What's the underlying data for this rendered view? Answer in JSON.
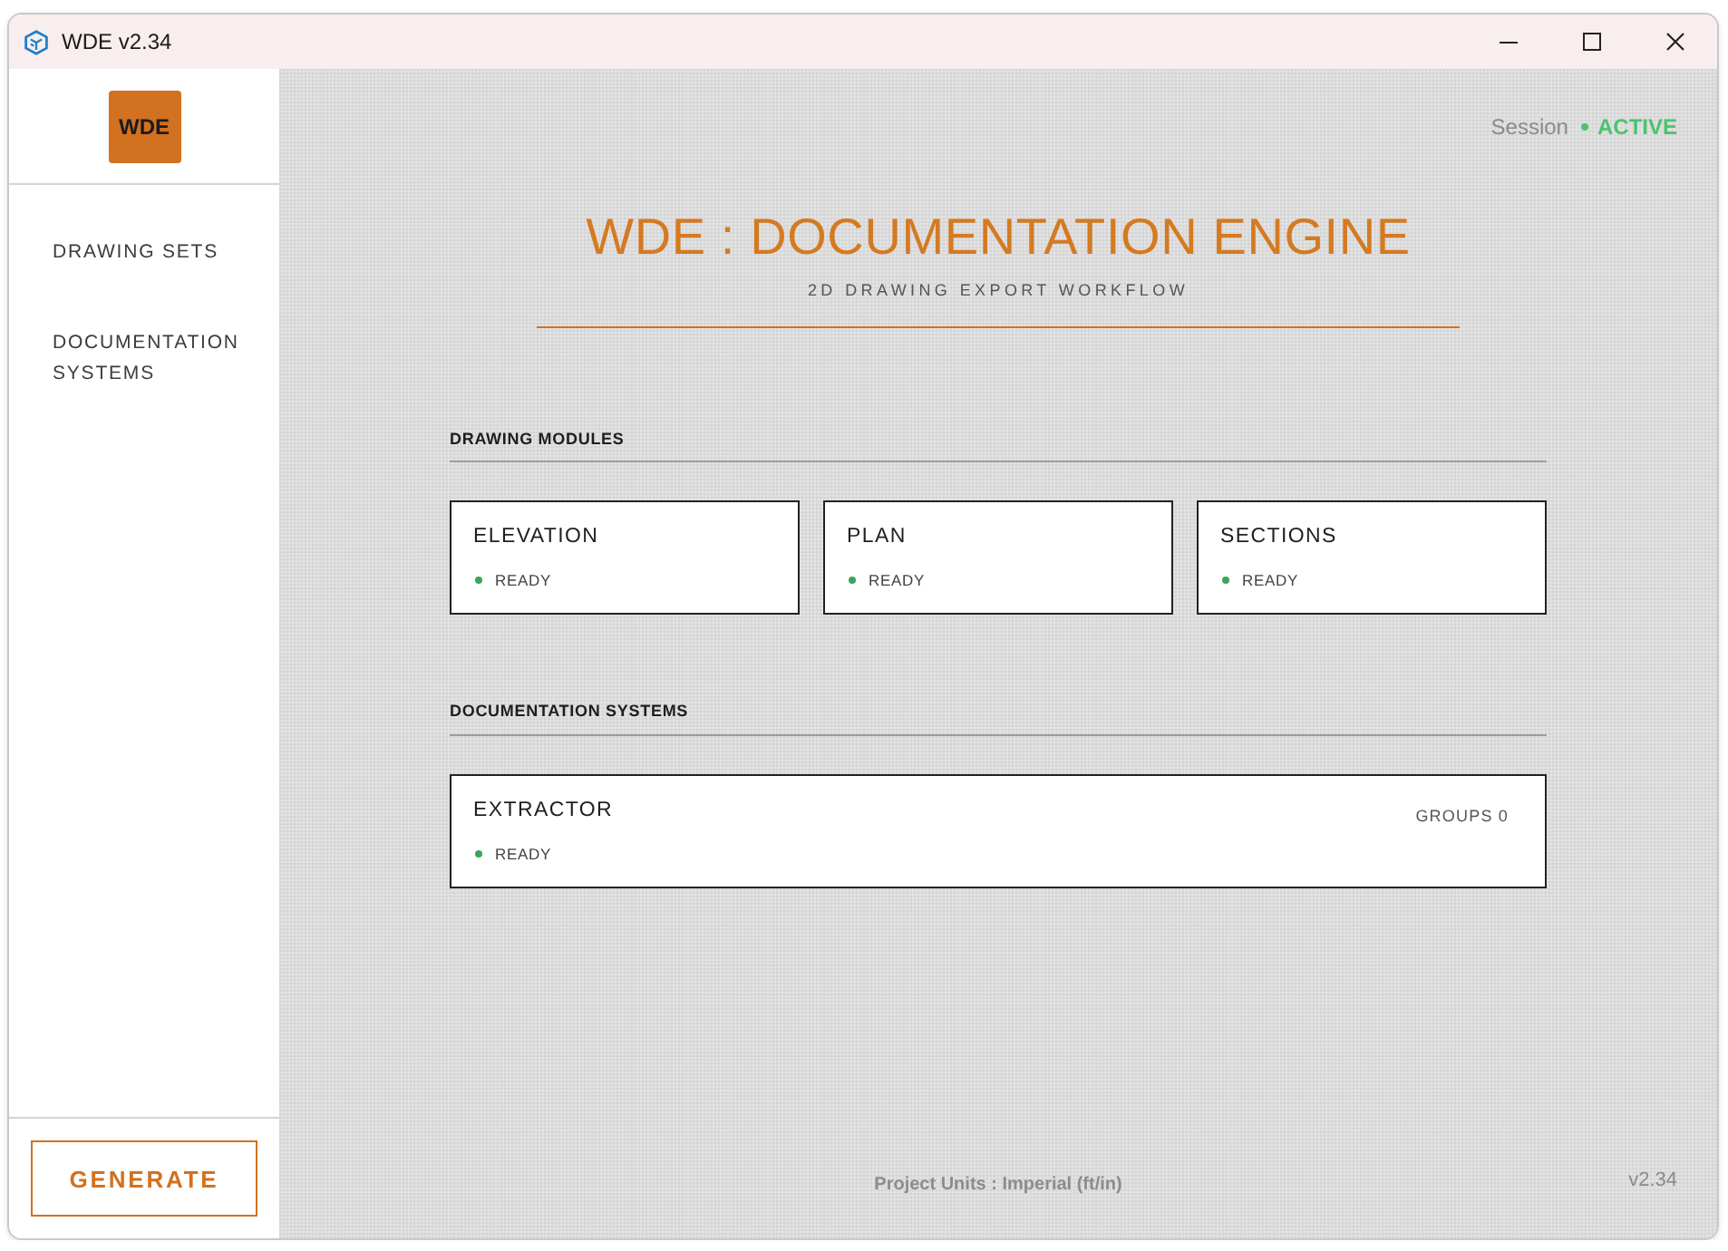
{
  "window": {
    "title": "WDE v2.34"
  },
  "sidebar": {
    "logo": "WDE",
    "items": [
      {
        "label": "DRAWING SETS",
        "selected": false
      },
      {
        "label": "DOCUMENTATION SYSTEMS",
        "selected": false
      }
    ],
    "generate_button": "GENERATE"
  },
  "session": {
    "label": "Session",
    "status": "ACTIVE",
    "active": true
  },
  "header": {
    "title": "WDE : DOCUMENTATION ENGINE",
    "subtitle": "2D DRAWING EXPORT WORKFLOW"
  },
  "sections": [
    {
      "title": "DRAWING MODULES",
      "modules": [
        {
          "name": "ELEVATION",
          "status": "READY",
          "ready": true
        },
        {
          "name": "PLAN",
          "status": "READY",
          "ready": true
        },
        {
          "name": "SECTIONS",
          "status": "READY",
          "ready": true
        }
      ]
    },
    {
      "title": "DOCUMENTATION SYSTEMS",
      "modules": [
        {
          "name": "EXTRACTOR",
          "status": "READY",
          "ready": true,
          "count": "GROUPS 0"
        }
      ]
    }
  ],
  "footer": {
    "units": "Project Units : Imperial (ft/in)",
    "version": "v2.34"
  }
}
